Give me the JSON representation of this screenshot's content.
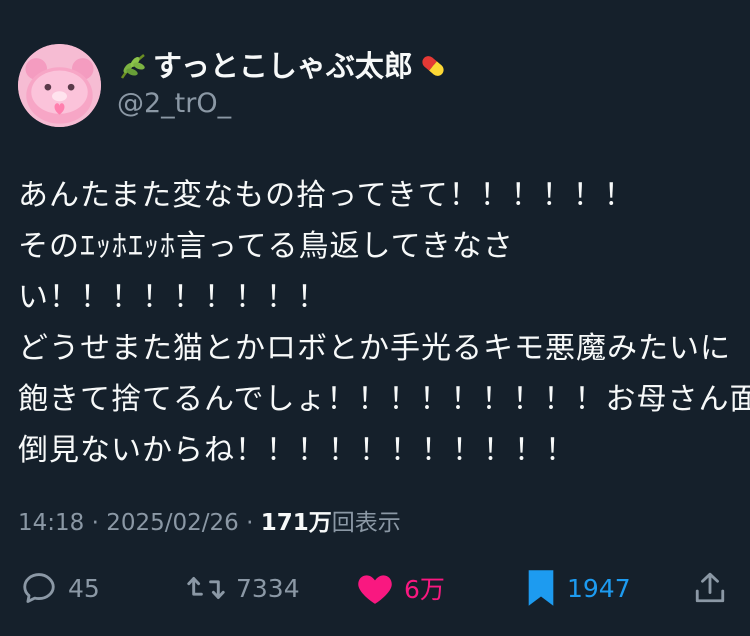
{
  "author": {
    "display_name": "すっとこしゃぶ太郎",
    "handle": "@2_trO_",
    "name_prefix_icon": "leaf-emoji-icon",
    "name_suffix_icon": "pill-emoji-icon"
  },
  "tweet": {
    "lines": [
      "あんたまた変なもの拾ってきて！！！！！！",
      "そのｴｯﾎｴｯﾎ言ってる鳥返してきなさ",
      "い！！！！！！！！！",
      "どうせまた猫とかロボとか手光るキモ悪魔みたいに",
      "飽きて捨てるんでしょ！！！！！！！！！お母さん面",
      "倒見ないからね！！！！！！！！！！！"
    ]
  },
  "meta": {
    "time": "14:18",
    "separator": " · ",
    "date": "2025/02/26",
    "views_count": "171万",
    "views_label": "回表示"
  },
  "actions": {
    "reply": {
      "icon": "reply-icon",
      "count": "45"
    },
    "retweet": {
      "icon": "retweet-icon",
      "count": "7334"
    },
    "like": {
      "icon": "heart-icon",
      "count": "6万",
      "active": true
    },
    "bookmark": {
      "icon": "bookmark-icon",
      "count": "1947",
      "active": true
    },
    "share": {
      "icon": "share-icon"
    }
  },
  "colors": {
    "background": "#15202b",
    "text": "#f7f9f9",
    "secondary": "#8b98a5",
    "like": "#f91880",
    "bookmark": "#1d9bf0"
  }
}
